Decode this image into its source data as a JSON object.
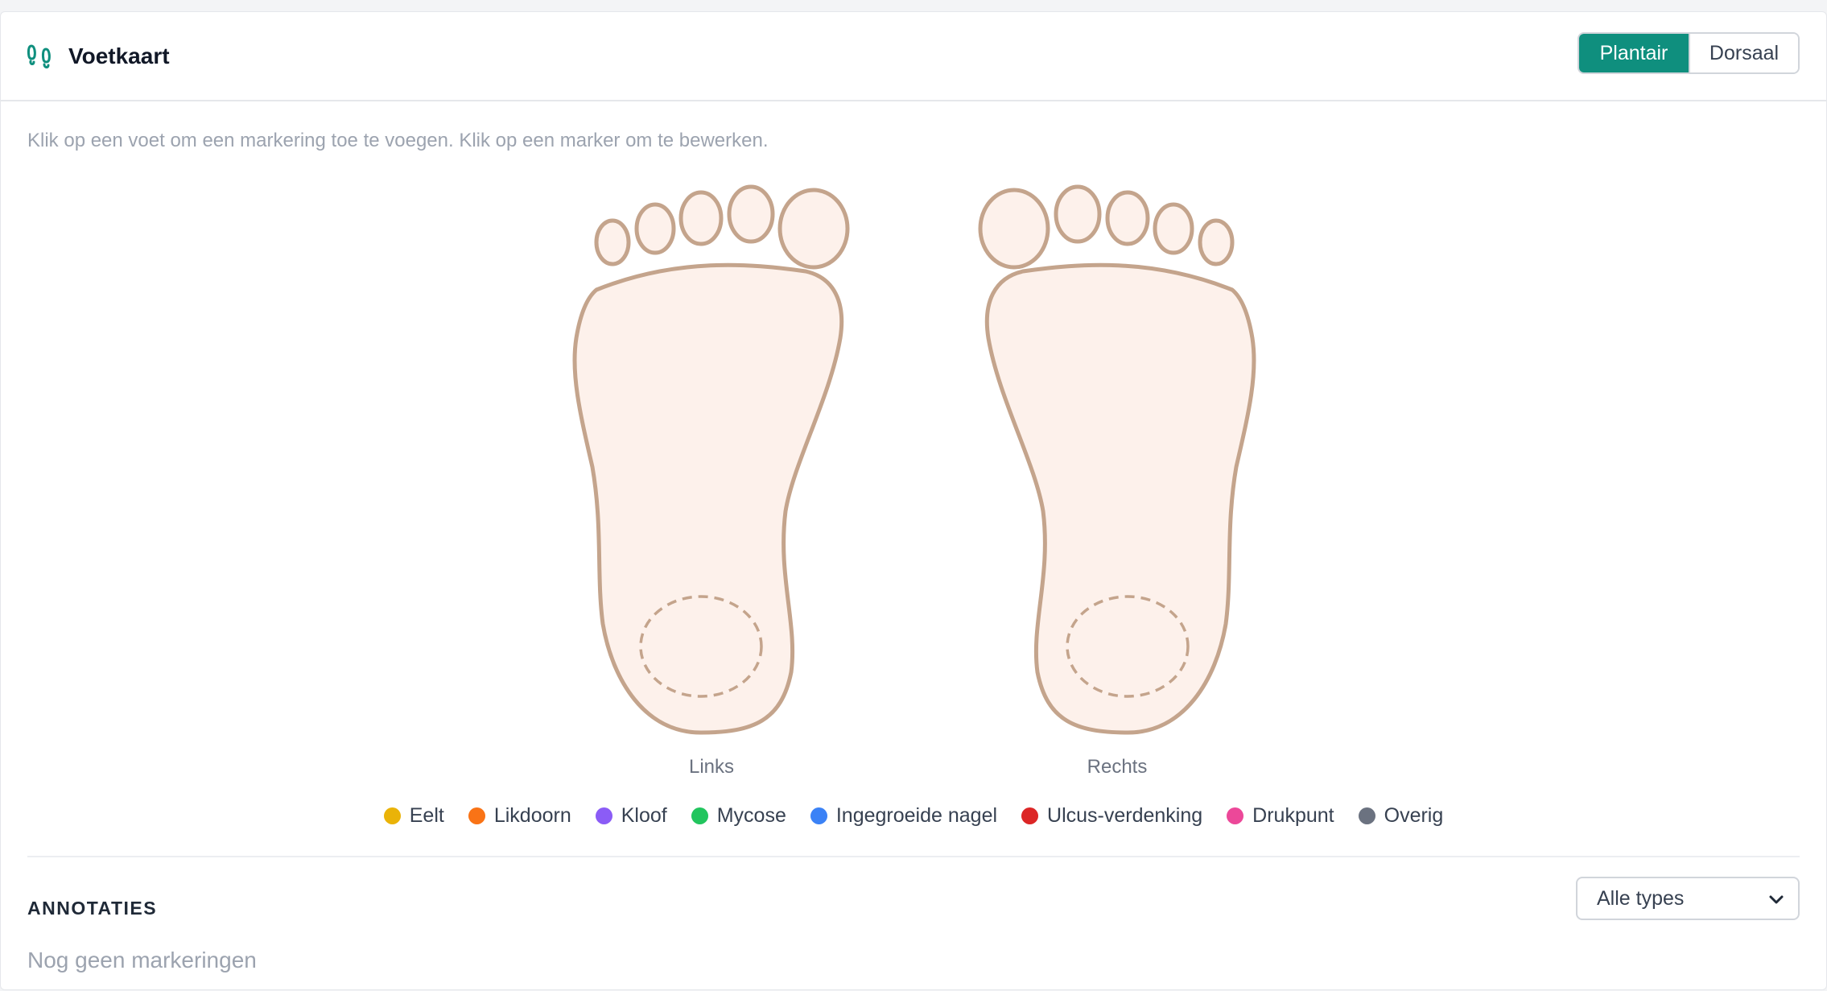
{
  "header": {
    "title": "Voetkaart",
    "icon": "footprints-icon"
  },
  "view_toggle": {
    "options": [
      "Plantair",
      "Dorsaal"
    ],
    "selected": "Plantair"
  },
  "hint": "Klik op een voet om een markering toe te voegen. Klik op een marker om te bewerken.",
  "feet": {
    "left_label": "Links",
    "right_label": "Rechts"
  },
  "legend": [
    {
      "label": "Eelt",
      "color": "#eab308"
    },
    {
      "label": "Likdoorn",
      "color": "#f97316"
    },
    {
      "label": "Kloof",
      "color": "#8b5cf6"
    },
    {
      "label": "Mycose",
      "color": "#22c55e"
    },
    {
      "label": "Ingegroeide nagel",
      "color": "#3b82f6"
    },
    {
      "label": "Ulcus-verdenking",
      "color": "#dc2626"
    },
    {
      "label": "Drukpunt",
      "color": "#ec4899"
    },
    {
      "label": "Overig",
      "color": "#6b7280"
    }
  ],
  "annotations": {
    "title": "ANNOTATIES",
    "filter_value": "Alle types",
    "empty_text": "Nog geen markeringen"
  },
  "colors": {
    "accent": "#0f8f7e",
    "foot_fill": "#fdf1eb",
    "foot_stroke": "#c4a48c"
  }
}
